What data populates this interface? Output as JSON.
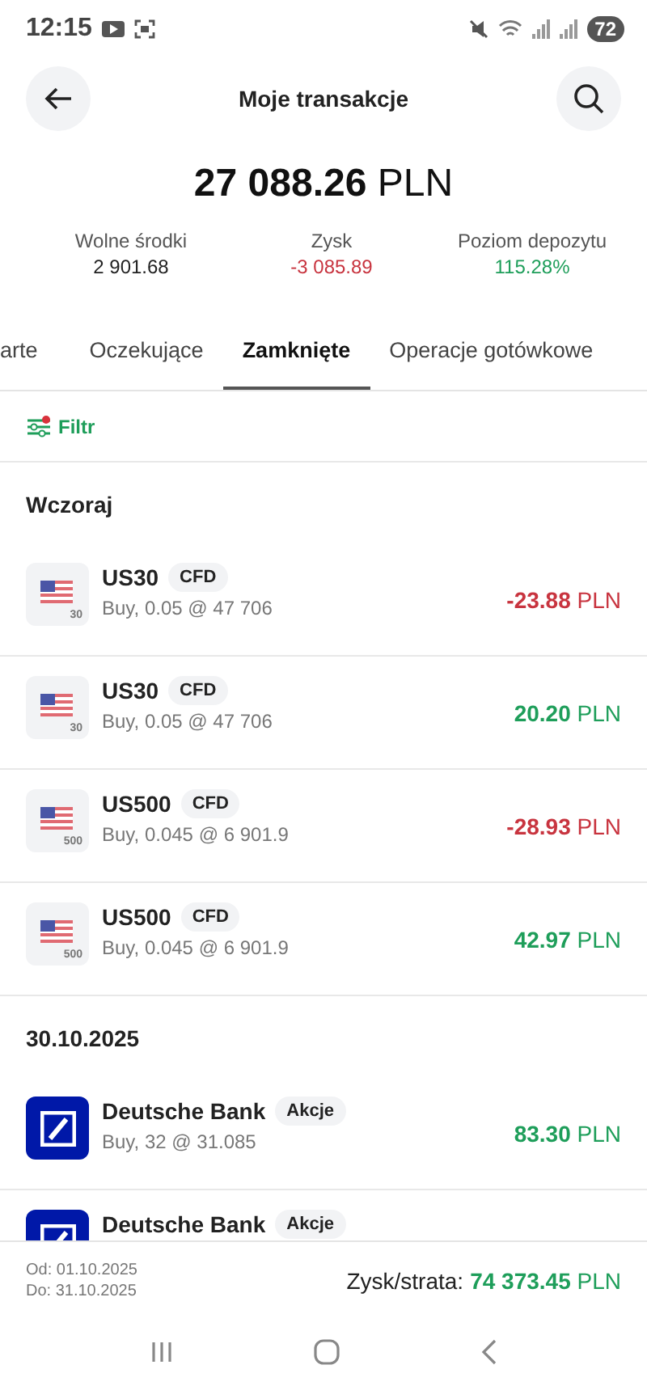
{
  "status_bar": {
    "time": "12:15",
    "battery": "72"
  },
  "header": {
    "title": "Moje transakcje"
  },
  "balance": {
    "amount": "**27 088.26** PLN"
  },
  "stats": [
    {
      "label": "Wolne środki",
      "value": "2 901.68",
      "color": "#222222"
    },
    {
      "label": "Zysk",
      "value": "-3 085.89",
      "color": "#c8343f"
    },
    {
      "label": "Poziom depozytu",
      "value": "115.28%",
      "color": "#1e9e5a"
    }
  ],
  "tabs": [
    {
      "label": "arte",
      "selected": false
    },
    {
      "label": "Oczekujące",
      "selected": false
    },
    {
      "label": "Zamknięte",
      "selected": true
    },
    {
      "label": "Operacje gotówkowe",
      "selected": false
    }
  ],
  "filter": {
    "label": "Filtr",
    "active": true
  },
  "sections": [
    {
      "title": "Wczoraj",
      "rows": [
        {
          "kind": "index",
          "badge_number": "30",
          "name": "US30",
          "tag": "CFD",
          "detail": "Buy, 0.05 @ 47 706",
          "amount": "**-23.88** PLN",
          "color": "#c8343f"
        },
        {
          "kind": "index",
          "badge_number": "30",
          "name": "US30",
          "tag": "CFD",
          "detail": "Buy, 0.05 @ 47 706",
          "amount": "**20.20** PLN",
          "color": "#1e9e5a"
        },
        {
          "kind": "index",
          "badge_number": "500",
          "name": "US500",
          "tag": "CFD",
          "detail": "Buy, 0.045 @ 6 901.9",
          "amount": "**-28.93** PLN",
          "color": "#c8343f"
        },
        {
          "kind": "index",
          "badge_number": "500",
          "name": "US500",
          "tag": "CFD",
          "detail": "Buy, 0.045 @ 6 901.9",
          "amount": "**42.97** PLN",
          "color": "#1e9e5a"
        }
      ]
    },
    {
      "title": "30.10.2025",
      "rows": [
        {
          "kind": "stock",
          "name": "Deutsche Bank",
          "tag": "Akcje",
          "detail": "Buy, 32 @ 31.085",
          "amount": "**83.30** PLN",
          "color": "#1e9e5a"
        },
        {
          "kind": "stock",
          "name": "Deutsche Bank",
          "tag": "Akcje"
        }
      ]
    }
  ],
  "footer": {
    "from": "Od: 01.10.2025",
    "to": "Do: 31.10.2025",
    "label": "Zysk/strata:",
    "value": "**74 373.45** PLN",
    "color": "#1e9e5a"
  }
}
